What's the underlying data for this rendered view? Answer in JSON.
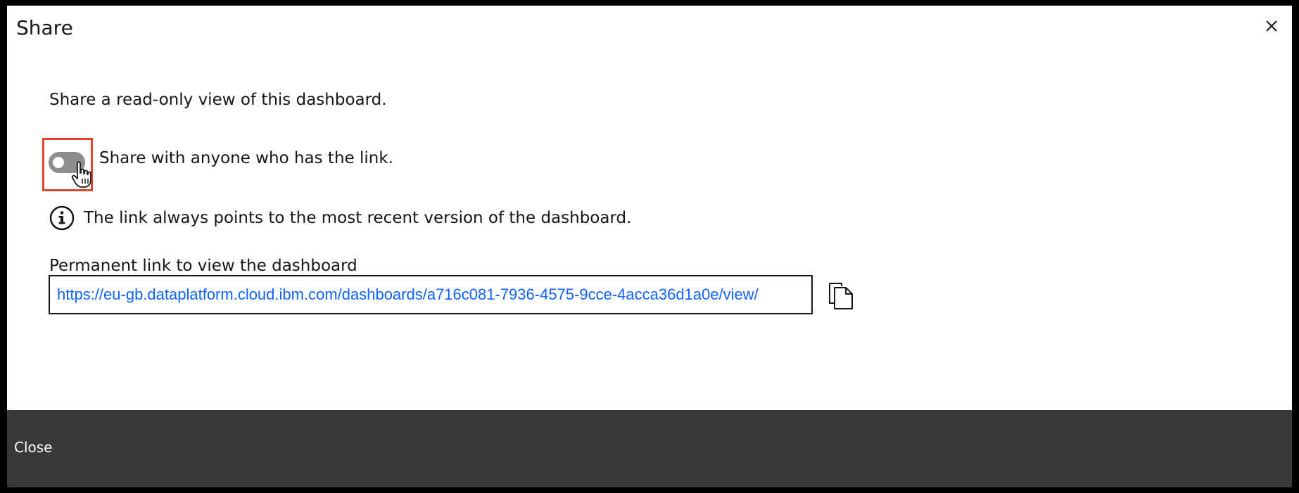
{
  "dialog": {
    "title": "Share",
    "close_icon": "close-icon"
  },
  "content": {
    "description": "Share a read-only view of this dashboard.",
    "toggle": {
      "label": "Share with anyone who has the link.",
      "state": "off"
    },
    "info": {
      "icon": "info-icon",
      "text": "The link always points to the most recent version of the dashboard."
    },
    "link": {
      "label": "Permanent link to view the dashboard",
      "value": "https://eu-gb.dataplatform.cloud.ibm.com/dashboards/a716c081-7936-4575-9cce-4acca36d1a0e/view/",
      "copy_icon": "copy-icon"
    }
  },
  "footer": {
    "close_label": "Close"
  },
  "colors": {
    "link": "#0f62fe",
    "footer_bg": "#393939",
    "highlight": "#e4442a",
    "toggle_off": "#8d8d8d"
  }
}
